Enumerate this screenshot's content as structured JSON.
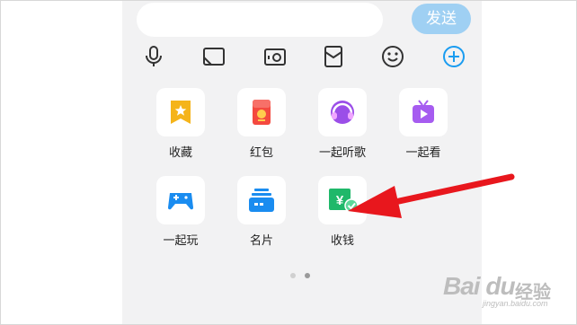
{
  "chat_input": {
    "value": "",
    "send_label": "发送"
  },
  "toolbar": {
    "icons": [
      "microphone-icon",
      "image-icon",
      "camera-icon",
      "red-packet-icon",
      "emoji-icon",
      "plus-icon"
    ],
    "accent": "#1a9cf0"
  },
  "panel": {
    "items": [
      {
        "label": "收藏",
        "icon": "favorites-icon"
      },
      {
        "label": "红包",
        "icon": "red-envelope-icon"
      },
      {
        "label": "一起听歌",
        "icon": "listen-together-icon"
      },
      {
        "label": "一起看",
        "icon": "watch-together-icon"
      },
      {
        "label": "一起玩",
        "icon": "game-controller-icon"
      },
      {
        "label": "名片",
        "icon": "business-card-icon"
      },
      {
        "label": "收钱",
        "icon": "receive-money-icon"
      }
    ],
    "page_indicator": {
      "current": 2,
      "total": 2
    }
  },
  "annotation": {
    "arrow_color": "#e8171d"
  },
  "watermark": {
    "brand": "Bai du",
    "cn": "经验",
    "url": "jingyan.baidu.com"
  }
}
